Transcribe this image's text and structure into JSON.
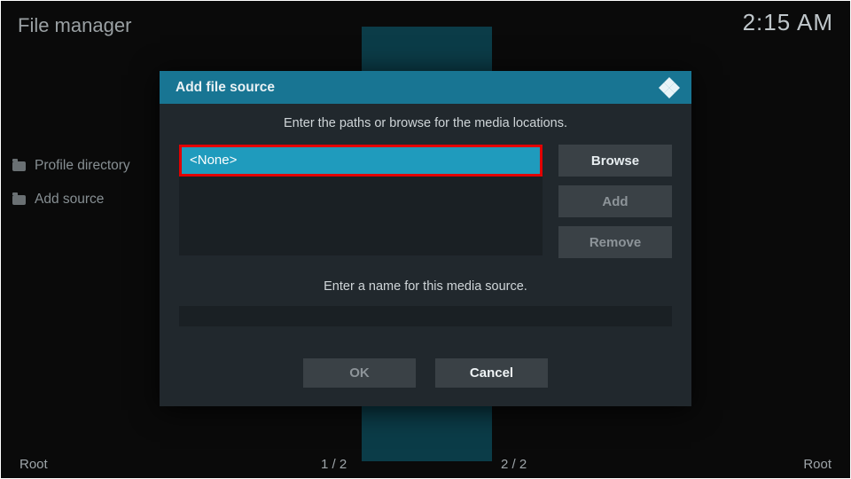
{
  "header": {
    "title": "File manager",
    "clock": "2:15 AM"
  },
  "sidebar": {
    "items": [
      {
        "label": "Profile directory"
      },
      {
        "label": "Add source"
      }
    ]
  },
  "footer": {
    "left_root": "Root",
    "right_root": "Root",
    "pager_left": "1 / 2",
    "pager_right": "2 / 2"
  },
  "dialog": {
    "title": "Add file source",
    "prompt_paths": "Enter the paths or browse for the media locations.",
    "path_value": "<None>",
    "browse_label": "Browse",
    "add_label": "Add",
    "remove_label": "Remove",
    "prompt_name": "Enter a name for this media source.",
    "name_value": "",
    "ok_label": "OK",
    "cancel_label": "Cancel"
  },
  "colors": {
    "accent": "#187593",
    "highlight": "#1f9bbd",
    "focus_border": "#e20000"
  }
}
